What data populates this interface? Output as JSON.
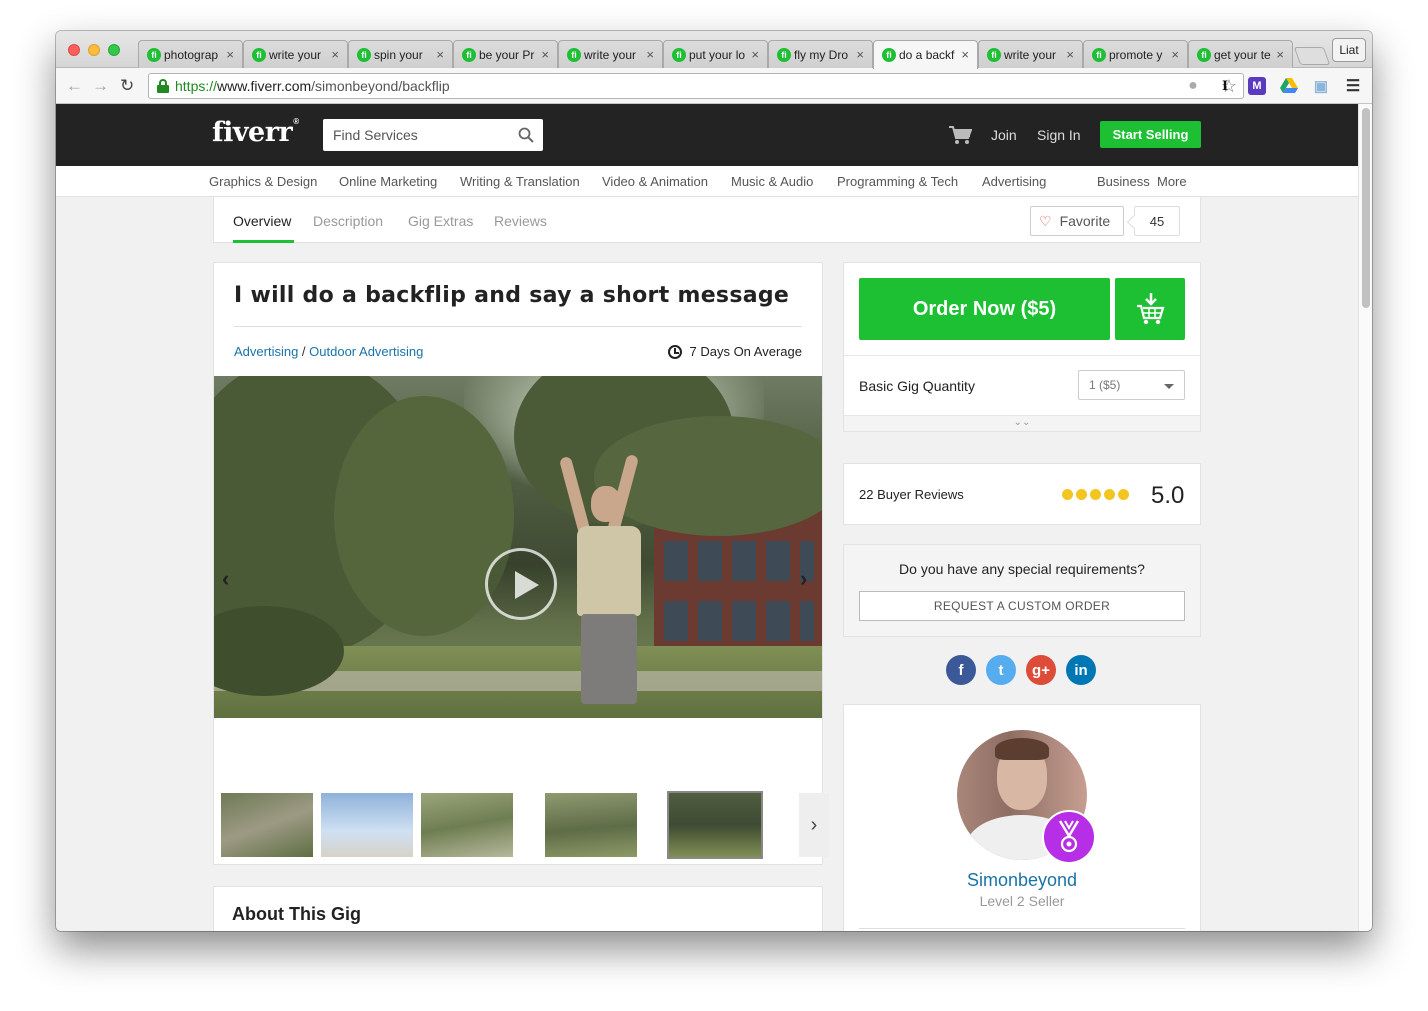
{
  "browser": {
    "tabs": [
      {
        "label": "photograp",
        "active": false
      },
      {
        "label": "write your",
        "active": false
      },
      {
        "label": "spin your",
        "active": false
      },
      {
        "label": "be your Pr",
        "active": false
      },
      {
        "label": "write your",
        "active": false
      },
      {
        "label": "put your lo",
        "active": false
      },
      {
        "label": "fly my Dro",
        "active": false
      },
      {
        "label": "do a backf",
        "active": true
      },
      {
        "label": "write your",
        "active": false
      },
      {
        "label": "promote y",
        "active": false
      },
      {
        "label": "get your te",
        "active": false
      }
    ],
    "tab_close": "×",
    "favicon_letter": "fi",
    "profile_label": "Liat",
    "url_scheme": "https://",
    "url_host": "www.fiverr.com",
    "url_path": "/simonbeyond/backflip",
    "extensions": [
      "evernote-icon",
      "instapaper-icon",
      "momentum-icon",
      "drive-icon",
      "screenshot-icon",
      "menu-icon"
    ]
  },
  "header": {
    "logo": "fiverr",
    "logo_mark": "®",
    "search_placeholder": "Find Services",
    "join": "Join",
    "sign_in": "Sign In",
    "start_selling": "Start Selling"
  },
  "categories": [
    "Graphics & Design",
    "Online Marketing",
    "Writing & Translation",
    "Video & Animation",
    "Music & Audio",
    "Programming & Tech",
    "Advertising",
    "Business",
    "More"
  ],
  "gig_nav": {
    "tabs": [
      "Overview",
      "Description",
      "Gig Extras",
      "Reviews"
    ],
    "active_tab": "Overview",
    "favorite_label": "Favorite",
    "favorite_count": "45"
  },
  "gig": {
    "title": "I will do a backflip and say a short message",
    "breadcrumb_category": "Advertising",
    "breadcrumb_separator": " / ",
    "breadcrumb_subcategory": "Outdoor Advertising",
    "delivery": "7 Days On Average",
    "about_title": "About This Gig"
  },
  "order": {
    "order_button": "Order Now ($5)",
    "quantity_label": "Basic Gig Quantity",
    "quantity_value": "1 ($5)",
    "expand_glyph": "⌄⌄"
  },
  "reviews": {
    "label": "22 Buyer Reviews",
    "rating": "5.0",
    "stars": 5,
    "star_color": "#f3c521"
  },
  "custom_order": {
    "question": "Do you have any special requirements?",
    "button": "REQUEST A CUSTOM ORDER"
  },
  "social": [
    {
      "name": "facebook-icon",
      "glyph": "f",
      "color": "#3b5998"
    },
    {
      "name": "twitter-icon",
      "glyph": "t",
      "color": "#55acee"
    },
    {
      "name": "googleplus-icon",
      "glyph": "g+",
      "color": "#dd4b39"
    },
    {
      "name": "linkedin-icon",
      "glyph": "in",
      "color": "#0077b5"
    }
  ],
  "seller": {
    "name": "Simonbeyond",
    "level": "Level 2 Seller"
  },
  "colors": {
    "brand_green": "#1dbf33",
    "header_bg": "#232323",
    "link_blue": "#1a73a8",
    "badge_purple": "#b62ee6"
  }
}
